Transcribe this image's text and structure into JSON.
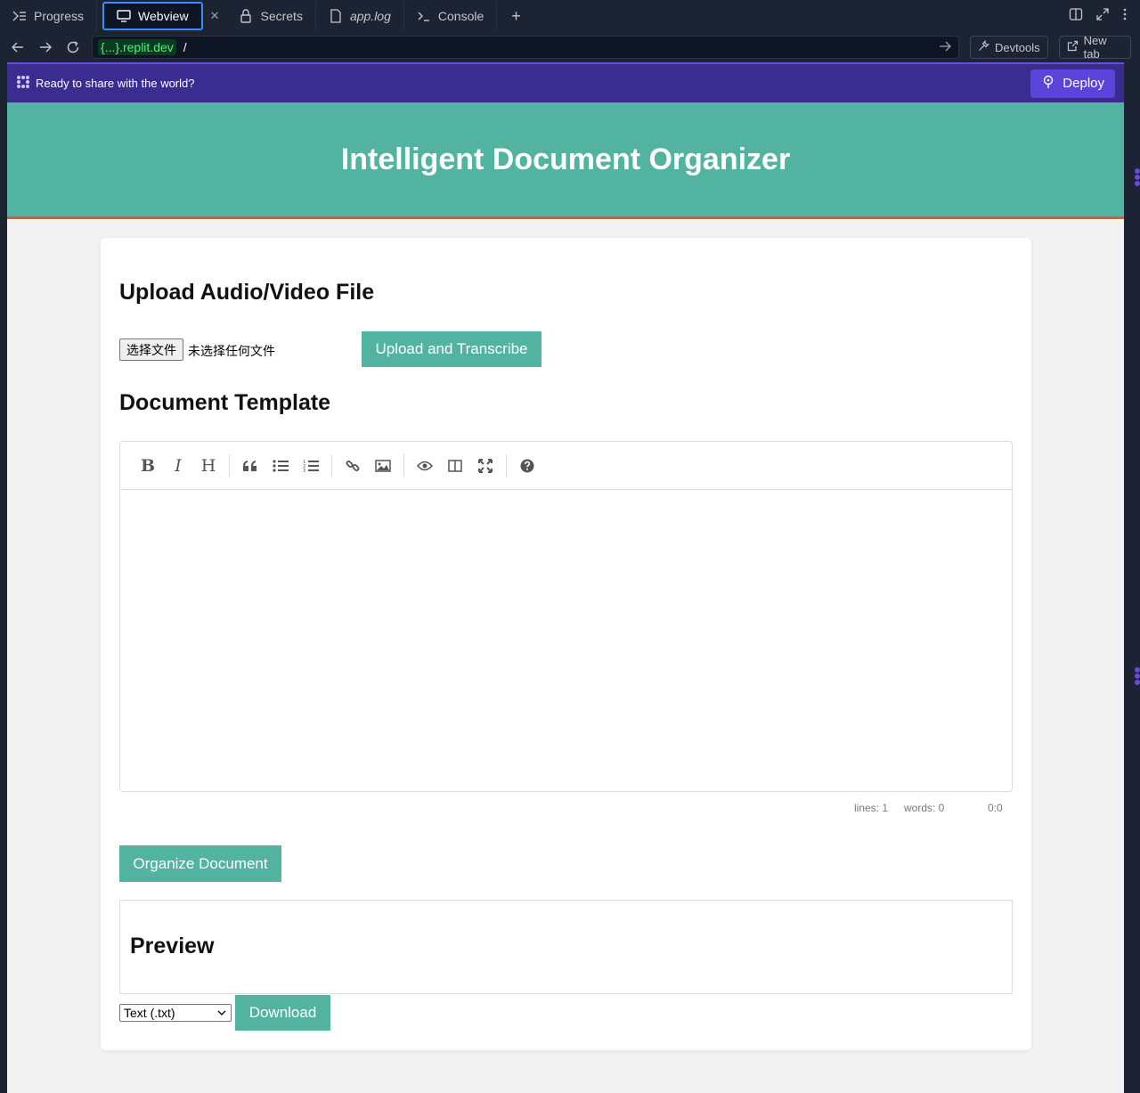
{
  "tabs": [
    {
      "label": "Progress",
      "icon": "progress-icon"
    },
    {
      "label": "Webview",
      "icon": "monitor-icon",
      "active": true
    },
    {
      "label": "Secrets",
      "icon": "lock-icon"
    },
    {
      "label": "app.log",
      "icon": "file-icon"
    },
    {
      "label": "Console",
      "icon": "terminal-icon"
    }
  ],
  "urlbar": {
    "host": "{...}.replit.dev",
    "path": "/",
    "devtools_label": "Devtools",
    "newtab_label": "New tab"
  },
  "banner": {
    "text": "Ready to share with the world?",
    "deploy_label": "Deploy"
  },
  "app": {
    "title": "Intelligent Document Organizer",
    "upload_heading": "Upload Audio/Video File",
    "choose_file_label": "选择文件",
    "no_file_text": "未选择任何文件",
    "upload_button": "Upload and Transcribe",
    "template_heading": "Document Template",
    "status": {
      "lines": "lines: 1",
      "words": "words: 0",
      "cursor": "0:0"
    },
    "organize_button": "Organize Document",
    "preview_heading": "Preview",
    "format_selected": "Text (.txt)",
    "download_button": "Download"
  },
  "colors": {
    "accent": "#53b3a1",
    "header_border": "#e2572d",
    "banner": "#3b2d8f",
    "deploy": "#5b44d9"
  }
}
